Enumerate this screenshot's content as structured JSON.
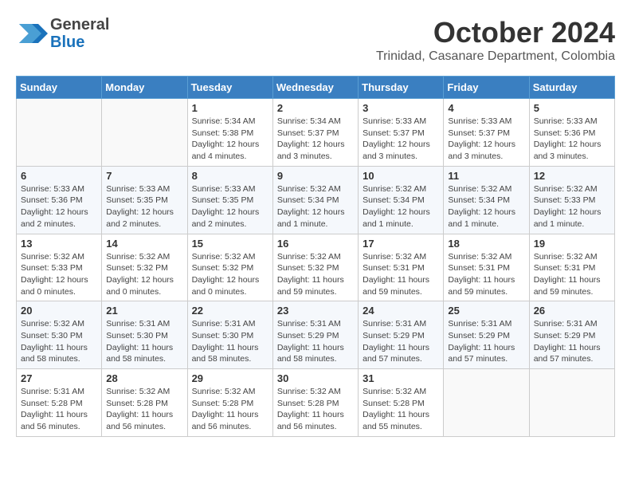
{
  "header": {
    "logo": {
      "line1": "General",
      "line2": "Blue"
    },
    "month": "October 2024",
    "location": "Trinidad, Casanare Department, Colombia"
  },
  "days_of_week": [
    "Sunday",
    "Monday",
    "Tuesday",
    "Wednesday",
    "Thursday",
    "Friday",
    "Saturday"
  ],
  "weeks": [
    [
      {
        "day": "",
        "info": ""
      },
      {
        "day": "",
        "info": ""
      },
      {
        "day": "1",
        "info": "Sunrise: 5:34 AM\nSunset: 5:38 PM\nDaylight: 12 hours\nand 4 minutes."
      },
      {
        "day": "2",
        "info": "Sunrise: 5:34 AM\nSunset: 5:37 PM\nDaylight: 12 hours\nand 3 minutes."
      },
      {
        "day": "3",
        "info": "Sunrise: 5:33 AM\nSunset: 5:37 PM\nDaylight: 12 hours\nand 3 minutes."
      },
      {
        "day": "4",
        "info": "Sunrise: 5:33 AM\nSunset: 5:37 PM\nDaylight: 12 hours\nand 3 minutes."
      },
      {
        "day": "5",
        "info": "Sunrise: 5:33 AM\nSunset: 5:36 PM\nDaylight: 12 hours\nand 3 minutes."
      }
    ],
    [
      {
        "day": "6",
        "info": "Sunrise: 5:33 AM\nSunset: 5:36 PM\nDaylight: 12 hours\nand 2 minutes."
      },
      {
        "day": "7",
        "info": "Sunrise: 5:33 AM\nSunset: 5:35 PM\nDaylight: 12 hours\nand 2 minutes."
      },
      {
        "day": "8",
        "info": "Sunrise: 5:33 AM\nSunset: 5:35 PM\nDaylight: 12 hours\nand 2 minutes."
      },
      {
        "day": "9",
        "info": "Sunrise: 5:32 AM\nSunset: 5:34 PM\nDaylight: 12 hours\nand 1 minute."
      },
      {
        "day": "10",
        "info": "Sunrise: 5:32 AM\nSunset: 5:34 PM\nDaylight: 12 hours\nand 1 minute."
      },
      {
        "day": "11",
        "info": "Sunrise: 5:32 AM\nSunset: 5:34 PM\nDaylight: 12 hours\nand 1 minute."
      },
      {
        "day": "12",
        "info": "Sunrise: 5:32 AM\nSunset: 5:33 PM\nDaylight: 12 hours\nand 1 minute."
      }
    ],
    [
      {
        "day": "13",
        "info": "Sunrise: 5:32 AM\nSunset: 5:33 PM\nDaylight: 12 hours\nand 0 minutes."
      },
      {
        "day": "14",
        "info": "Sunrise: 5:32 AM\nSunset: 5:32 PM\nDaylight: 12 hours\nand 0 minutes."
      },
      {
        "day": "15",
        "info": "Sunrise: 5:32 AM\nSunset: 5:32 PM\nDaylight: 12 hours\nand 0 minutes."
      },
      {
        "day": "16",
        "info": "Sunrise: 5:32 AM\nSunset: 5:32 PM\nDaylight: 11 hours\nand 59 minutes."
      },
      {
        "day": "17",
        "info": "Sunrise: 5:32 AM\nSunset: 5:31 PM\nDaylight: 11 hours\nand 59 minutes."
      },
      {
        "day": "18",
        "info": "Sunrise: 5:32 AM\nSunset: 5:31 PM\nDaylight: 11 hours\nand 59 minutes."
      },
      {
        "day": "19",
        "info": "Sunrise: 5:32 AM\nSunset: 5:31 PM\nDaylight: 11 hours\nand 59 minutes."
      }
    ],
    [
      {
        "day": "20",
        "info": "Sunrise: 5:32 AM\nSunset: 5:30 PM\nDaylight: 11 hours\nand 58 minutes."
      },
      {
        "day": "21",
        "info": "Sunrise: 5:31 AM\nSunset: 5:30 PM\nDaylight: 11 hours\nand 58 minutes."
      },
      {
        "day": "22",
        "info": "Sunrise: 5:31 AM\nSunset: 5:30 PM\nDaylight: 11 hours\nand 58 minutes."
      },
      {
        "day": "23",
        "info": "Sunrise: 5:31 AM\nSunset: 5:29 PM\nDaylight: 11 hours\nand 58 minutes."
      },
      {
        "day": "24",
        "info": "Sunrise: 5:31 AM\nSunset: 5:29 PM\nDaylight: 11 hours\nand 57 minutes."
      },
      {
        "day": "25",
        "info": "Sunrise: 5:31 AM\nSunset: 5:29 PM\nDaylight: 11 hours\nand 57 minutes."
      },
      {
        "day": "26",
        "info": "Sunrise: 5:31 AM\nSunset: 5:29 PM\nDaylight: 11 hours\nand 57 minutes."
      }
    ],
    [
      {
        "day": "27",
        "info": "Sunrise: 5:31 AM\nSunset: 5:28 PM\nDaylight: 11 hours\nand 56 minutes."
      },
      {
        "day": "28",
        "info": "Sunrise: 5:32 AM\nSunset: 5:28 PM\nDaylight: 11 hours\nand 56 minutes."
      },
      {
        "day": "29",
        "info": "Sunrise: 5:32 AM\nSunset: 5:28 PM\nDaylight: 11 hours\nand 56 minutes."
      },
      {
        "day": "30",
        "info": "Sunrise: 5:32 AM\nSunset: 5:28 PM\nDaylight: 11 hours\nand 56 minutes."
      },
      {
        "day": "31",
        "info": "Sunrise: 5:32 AM\nSunset: 5:28 PM\nDaylight: 11 hours\nand 55 minutes."
      },
      {
        "day": "",
        "info": ""
      },
      {
        "day": "",
        "info": ""
      }
    ]
  ]
}
